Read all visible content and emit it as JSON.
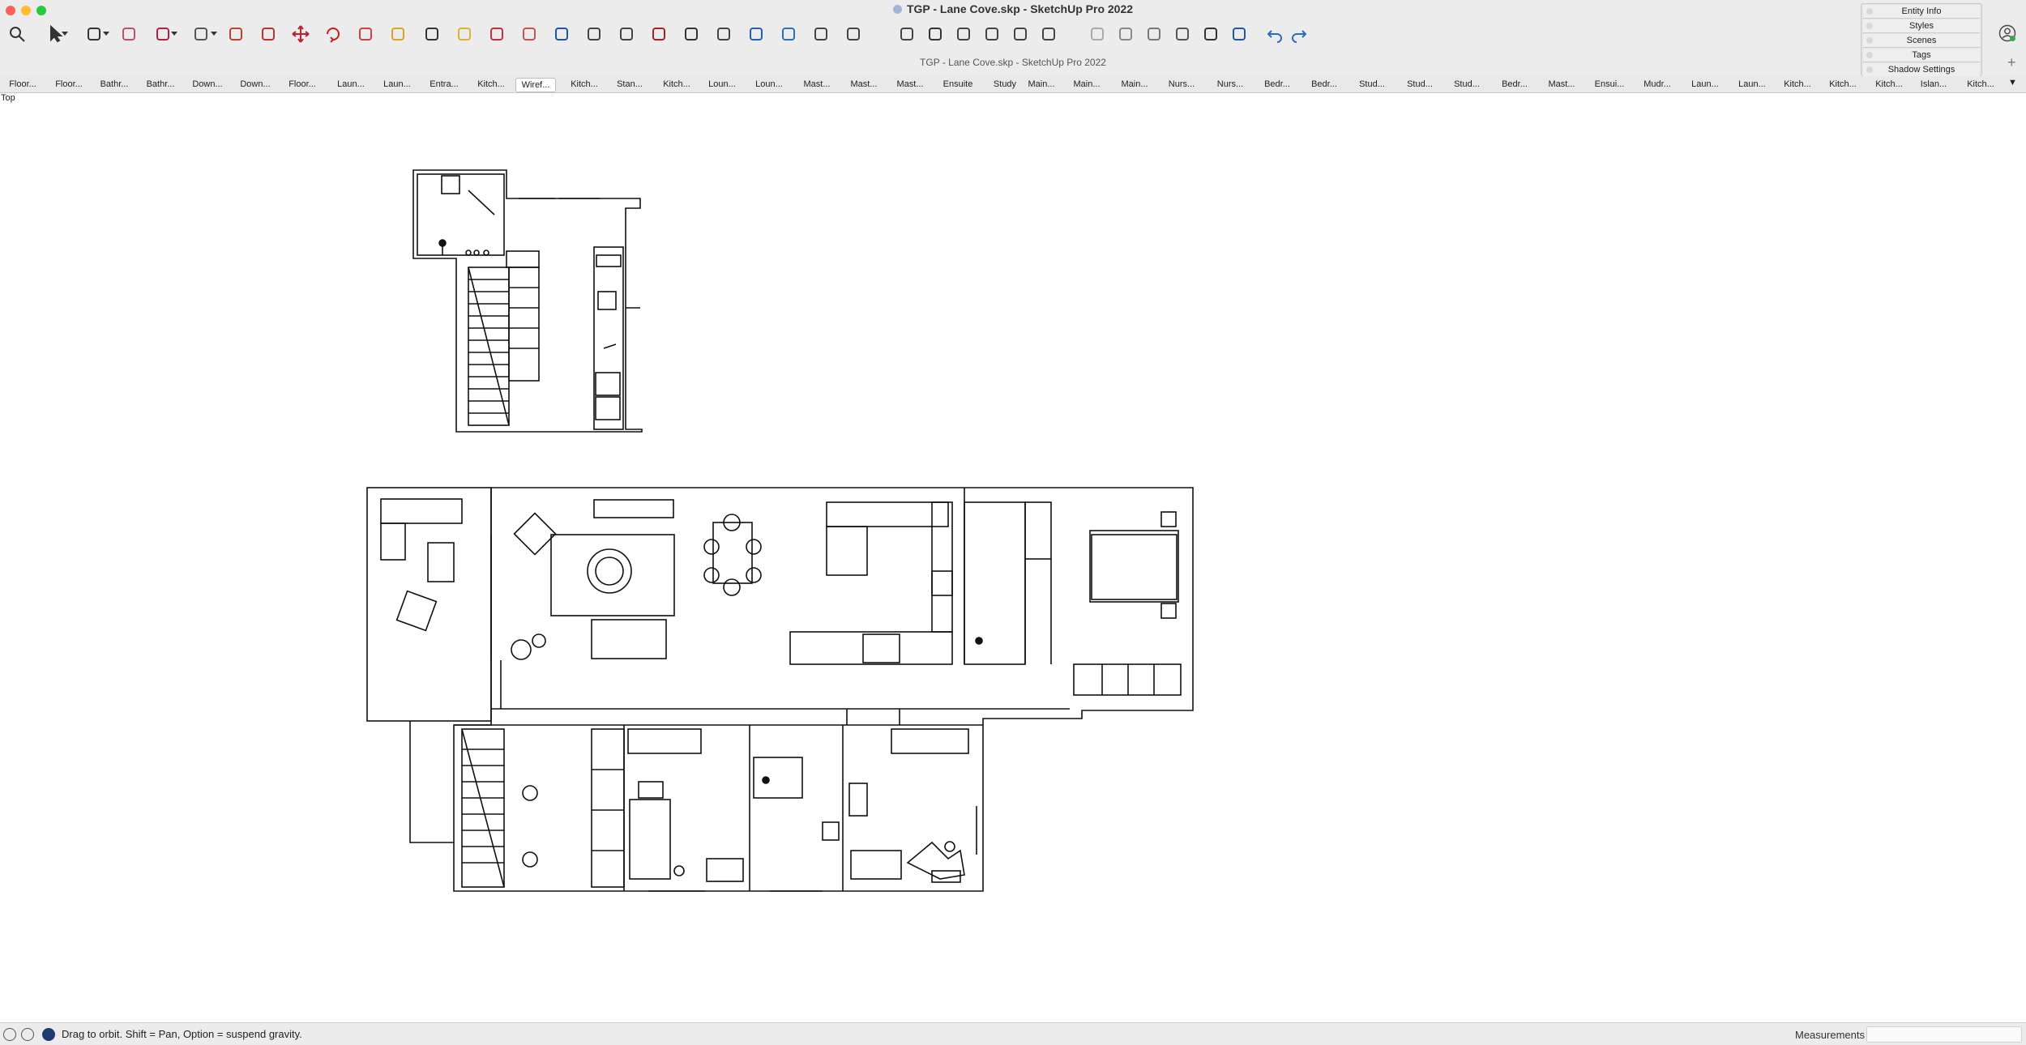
{
  "window": {
    "title": "TGP - Lane Cove.skp - SketchUp Pro 2022",
    "subtitle": "TGP - Lane Cove.skp - SketchUp Pro 2022"
  },
  "toolbar": {
    "tools": [
      "search-icon",
      "select-icon",
      "pencil-icon",
      "eraser-icon",
      "arc-icon",
      "rectangle-icon",
      "push-pull-icon",
      "offset-icon",
      "move-icon",
      "rotate-icon",
      "scale-icon",
      "tape-measure-icon",
      "text-icon",
      "paint-bucket-icon",
      "orbit-icon",
      "pan-icon",
      "zoom-icon",
      "zoom-window-icon",
      "zoom-extents-icon",
      "position-camera-icon",
      "walk-icon",
      "look-around-icon",
      "section-plane-icon",
      "sandbox-icon",
      "3d-warehouse-icon",
      "extension-icon",
      "iso-view-icon",
      "top-view-icon",
      "front-view-icon",
      "right-view-icon",
      "back-view-icon",
      "left-view-icon",
      "xray-icon",
      "wireframe-icon",
      "hidden-line-icon",
      "shaded-icon",
      "textured-icon",
      "monochrome-icon",
      "undo-icon",
      "redo-icon"
    ]
  },
  "tray": {
    "items": [
      "Entity Info",
      "Styles",
      "Scenes",
      "Tags",
      "Shadow Settings"
    ]
  },
  "scene_tabs": {
    "items": [
      "Floor...",
      "Floor...",
      "Bathr...",
      "Bathr...",
      "Down...",
      "Down...",
      "Floor...",
      "Laun...",
      "Laun...",
      "Entra...",
      "Kitch...",
      "Wiref...",
      "Kitch...",
      "Stan...",
      "Kitch...",
      "Loun...",
      "Loun...",
      "Mast...",
      "Mast...",
      "Mast...",
      "Ensuite",
      "Study",
      "Main...",
      "Main...",
      "Main...",
      "Nurs...",
      "Nurs...",
      "Bedr...",
      "Bedr...",
      "Stud...",
      "Stud...",
      "Stud...",
      "Bedr...",
      "Mast...",
      "Ensui...",
      "Mudr...",
      "Laun...",
      "Laun...",
      "Kitch...",
      "Kitch...",
      "Kitch...",
      "Islan...",
      "Kitch..."
    ],
    "active_index": 11,
    "more": "▼"
  },
  "viewport": {
    "view_label": "Top"
  },
  "status": {
    "message": "Drag to orbit. Shift = Pan, Option = suspend gravity.",
    "measurements_label": "Measurements",
    "measurements_value": ""
  }
}
